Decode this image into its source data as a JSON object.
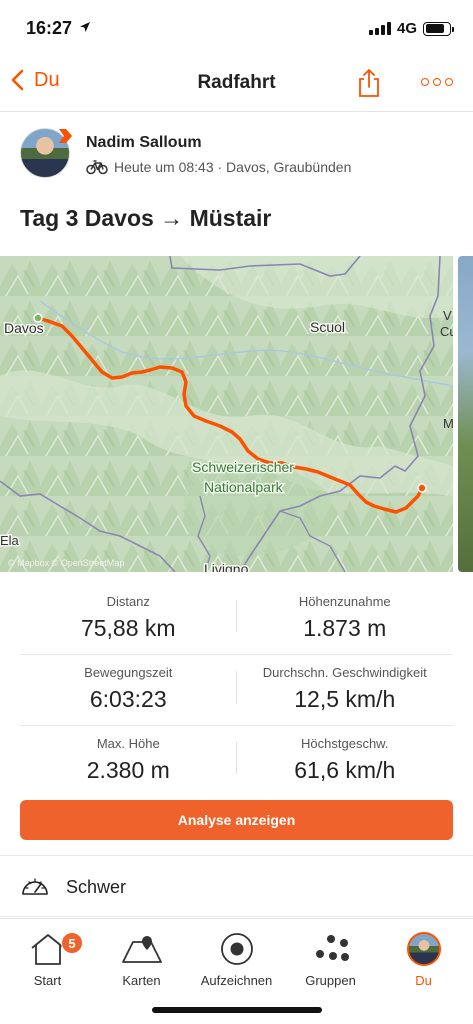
{
  "status_bar": {
    "time": "16:27",
    "network": "4G",
    "location_icon": "location-arrow-icon"
  },
  "nav": {
    "back_label": "Du",
    "title": "Radfahrt",
    "share_icon": "share-icon",
    "more_icon": "more-dots-icon"
  },
  "header": {
    "athlete_name": "Nadim Salloum",
    "meta": "Heute um 08:43 · Davos, Graubünden",
    "activity_icon": "bike-icon"
  },
  "activity_title": "Tag 3 Davos → Müstair",
  "map": {
    "labels": {
      "davos": "Davos",
      "scuol": "Scuol",
      "park_line1": "Schweizerischer",
      "park_line2": "Nationalpark",
      "livigno": "Livigno",
      "zla": "Ela",
      "v": "V",
      "cu": "Cu",
      "m": "M"
    },
    "attribution": "© Mapbox © OpenStreetMap",
    "route_color": "#fc5200"
  },
  "stats": [
    {
      "label_left": "Distanz",
      "value_left": "75,88 km",
      "label_right": "Höhenzunahme",
      "value_right": "1.873 m"
    },
    {
      "label_left": "Bewegungszeit",
      "value_left": "6:03:23",
      "label_right": "Durchschn. Geschwindigkeit",
      "value_right": "12,5 km/h"
    },
    {
      "label_left": "Max. Höhe",
      "value_left": "2.380 m",
      "label_right": "Höchstgeschw.",
      "value_right": "61,6 km/h"
    }
  ],
  "analyse_button": "Analyse anzeigen",
  "effort": {
    "label": "Schwer",
    "icon": "gauge-icon"
  },
  "tabs": [
    {
      "label": "Start",
      "icon": "home-icon",
      "badge": "5"
    },
    {
      "label": "Karten",
      "icon": "map-icon"
    },
    {
      "label": "Aufzeichnen",
      "icon": "record-icon"
    },
    {
      "label": "Gruppen",
      "icon": "groups-icon"
    },
    {
      "label": "Du",
      "icon": "profile-avatar",
      "active": true
    }
  ],
  "colors": {
    "accent": "#fc5200",
    "button": "#f0622b"
  }
}
